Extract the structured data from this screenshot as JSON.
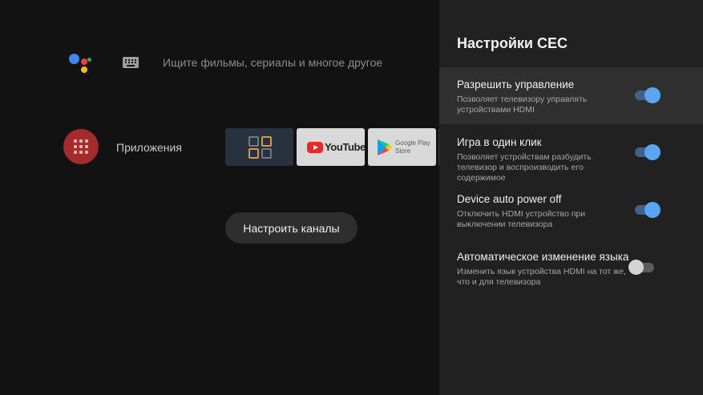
{
  "search": {
    "placeholder_text": "Ищите фильмы, сериалы и многое другое"
  },
  "apps_row": {
    "label": "Приложения",
    "tiles": [
      {
        "name": "apps-launcher"
      },
      {
        "name": "YouTube",
        "text": "YouTube"
      },
      {
        "name": "Google Play Store",
        "text_line1": "Google Play",
        "text_line2": "Store"
      }
    ]
  },
  "channels_button": {
    "label": "Настроить каналы"
  },
  "settings_panel": {
    "title": "Настройки CEC",
    "items": [
      {
        "title": "Разрешить управление",
        "description": "Позволяет телевизору управлять устройствами HDMI",
        "enabled": true,
        "selected": true
      },
      {
        "title": "Игра в один клик",
        "description": "Позволяет устройствам разбудить телевизор и воспроизводить его содержимое",
        "enabled": true,
        "selected": false
      },
      {
        "title": "Device auto power off",
        "description": "Отключить HDMI устройство при выключении телевизора",
        "enabled": true,
        "selected": false
      },
      {
        "title": "Автоматическое изменение языка",
        "description": "Изменить язык устройства HDMI на тот же, что и для телевизора",
        "enabled": false,
        "selected": false
      }
    ]
  },
  "colors": {
    "accent": "#5aa5f2",
    "panel_background": "#212121",
    "home_background": "#121212",
    "apps_circle": "#a32b2b"
  },
  "icons": [
    "google-assistant-icon",
    "keyboard-icon",
    "apps-grid-icon",
    "youtube-icon",
    "google-play-icon"
  ]
}
